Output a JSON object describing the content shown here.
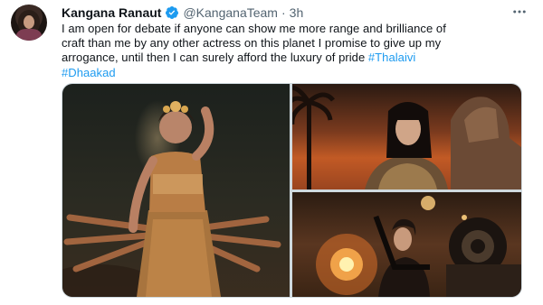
{
  "author": {
    "name": "Kangana Ranaut",
    "handle": "@KanganaTeam",
    "separator": "·",
    "time": "3h",
    "verified_color": "#1d9bf0"
  },
  "tweet": {
    "lines": [
      "I am open for debate if anyone can show me more range and brilliance of",
      "craft than me by any other actress on this planet I promise to give up my",
      "arrogance, until then I can surely afford the luxury of pride "
    ],
    "hashtags": [
      "#Thalaivi",
      "#Dhaakad"
    ]
  },
  "colors": {
    "text": "#0f1419",
    "secondary": "#536471",
    "link": "#1d9bf0",
    "border": "#cfd9de"
  },
  "icons": {
    "verified": "verified-badge-icon",
    "more": "more-options-icon"
  }
}
